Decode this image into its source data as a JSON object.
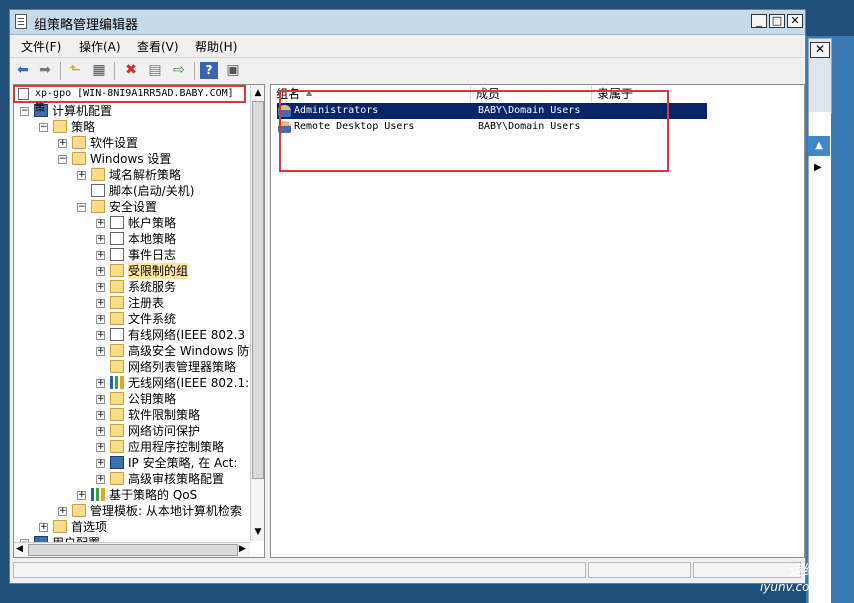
{
  "window": {
    "title": "组策略管理编辑器"
  },
  "menu": [
    "文件(F)",
    "操作(A)",
    "查看(V)",
    "帮助(H)"
  ],
  "tree": {
    "root_label": "xp-gpo [WIN-8NI9A1RR5AD.BABY.COM] 策",
    "rows": [
      {
        "label": "计算机配置",
        "exp": "−",
        "icon": "computer-icon"
      },
      {
        "label": "策略",
        "exp": "−",
        "icon": "folder-icon"
      },
      {
        "label": "软件设置",
        "exp": "+",
        "icon": "folder-icon"
      },
      {
        "label": "Windows 设置",
        "exp": "−",
        "icon": "folder-icon"
      },
      {
        "label": "域名解析策略",
        "exp": "+",
        "icon": "folder-icon"
      },
      {
        "label": "脚本(启动/关机)",
        "exp": "",
        "icon": "script-icon"
      },
      {
        "label": "安全设置",
        "exp": "−",
        "icon": "security-icon"
      },
      {
        "label": "帐户策略",
        "exp": "+",
        "icon": "policy-icon"
      },
      {
        "label": "本地策略",
        "exp": "+",
        "icon": "policy-icon"
      },
      {
        "label": "事件日志",
        "exp": "+",
        "icon": "policy-icon"
      },
      {
        "label": "受限制的组",
        "exp": "+",
        "icon": "folder-lock-icon"
      },
      {
        "label": "系统服务",
        "exp": "+",
        "icon": "folder-lock-icon"
      },
      {
        "label": "注册表",
        "exp": "+",
        "icon": "folder-lock-icon"
      },
      {
        "label": "文件系统",
        "exp": "+",
        "icon": "folder-lock-icon"
      },
      {
        "label": "有线网络(IEEE 802.3",
        "exp": "+",
        "icon": "network-icon"
      },
      {
        "label": "高级安全 Windows 防:",
        "exp": "+",
        "icon": "folder-icon"
      },
      {
        "label": "网络列表管理器策略",
        "exp": "",
        "icon": "folder-icon"
      },
      {
        "label": "无线网络(IEEE 802.1:",
        "exp": "+",
        "icon": "wireless-icon"
      },
      {
        "label": "公钥策略",
        "exp": "+",
        "icon": "folder-icon"
      },
      {
        "label": "软件限制策略",
        "exp": "+",
        "icon": "folder-icon"
      },
      {
        "label": "网络访问保护",
        "exp": "+",
        "icon": "folder-icon"
      },
      {
        "label": "应用程序控制策略",
        "exp": "+",
        "icon": "folder-icon"
      },
      {
        "label": "IP 安全策略, 在 Act:",
        "exp": "+",
        "icon": "ip-security-icon"
      },
      {
        "label": "高级审核策略配置",
        "exp": "+",
        "icon": "folder-icon"
      },
      {
        "label": "基于策略的 QoS",
        "exp": "+",
        "icon": "chart-icon"
      },
      {
        "label": "管理模板: 从本地计算机检索",
        "exp": "+",
        "icon": "folder-icon"
      },
      {
        "label": "首选项",
        "exp": "+",
        "icon": "folder-icon"
      },
      {
        "label": "用户配置",
        "exp": "−",
        "icon": "user-icon"
      }
    ]
  },
  "table": {
    "columns": [
      "组名",
      "成员",
      "隶属于"
    ],
    "rows": [
      {
        "name": "Administrators",
        "members": "BABY\\Domain Users",
        "member_of": ""
      },
      {
        "name": "Remote Desktop Users",
        "members": "BABY\\Domain Users",
        "member_of": ""
      }
    ],
    "selected_index": 0
  },
  "watermark": {
    "title": "运维网",
    "url": "iyunv.com"
  }
}
